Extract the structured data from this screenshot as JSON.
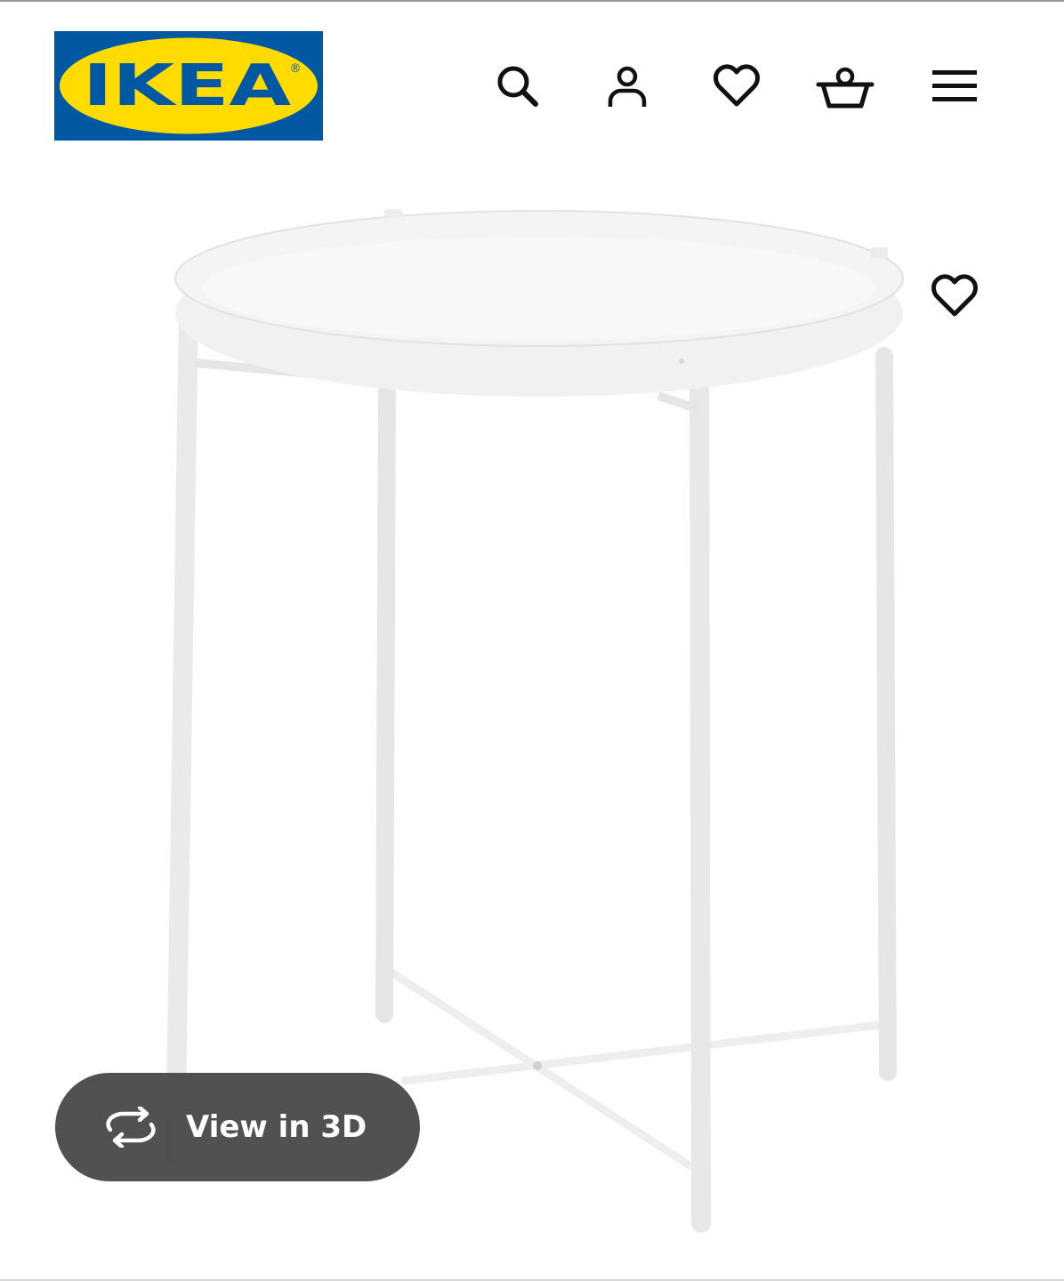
{
  "header": {
    "logo_text": "IKEA",
    "logo_mark": "®",
    "icons": {
      "search": "search-icon",
      "account": "account-icon",
      "favourites": "heart-icon",
      "cart": "shopping-basket-icon",
      "menu": "hamburger-menu-icon"
    }
  },
  "product": {
    "image": "white round tray table",
    "favourite_icon": "heart-icon",
    "view_3d": {
      "label": "View in 3D",
      "icon": "rotate-3d-icon"
    }
  },
  "colors": {
    "brand_blue": "#0058a3",
    "brand_yellow": "#ffdb00",
    "pill_bg": "#484848"
  }
}
